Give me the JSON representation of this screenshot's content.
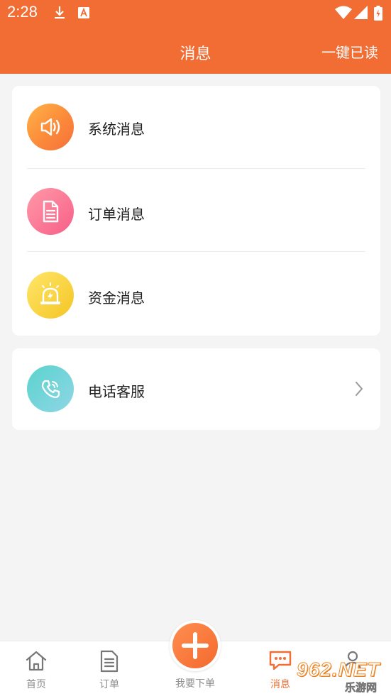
{
  "status_bar": {
    "time": "2:28",
    "icons": [
      "download-icon",
      "a-app-icon",
      "wifi-icon",
      "signal-icon",
      "battery-icon"
    ]
  },
  "header": {
    "title": "消息",
    "action_label": "一键已读"
  },
  "message_categories": [
    {
      "label": "系统消息",
      "icon": "speaker-icon"
    },
    {
      "label": "订单消息",
      "icon": "document-icon"
    },
    {
      "label": "资金消息",
      "icon": "alarm-icon"
    }
  ],
  "support": {
    "label": "电话客服",
    "icon": "phone-icon"
  },
  "bottom_nav": {
    "home": "首页",
    "orders": "订单",
    "place_order": "我要下单",
    "messages": "消息",
    "active": "messages"
  },
  "watermark": {
    "brand": "962.NET",
    "site": "乐游网"
  },
  "colors": {
    "accent": "#f16d33",
    "background": "#f4f4f4",
    "inactive_text": "#8c8c8c"
  }
}
